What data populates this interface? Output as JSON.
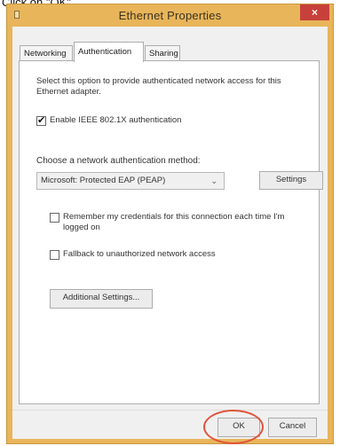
{
  "caption": "Click on \"OK\"",
  "window": {
    "title": "Ethernet Properties",
    "close_glyph": "×"
  },
  "tabs": [
    {
      "label": "Networking",
      "active": false
    },
    {
      "label": "Authentication",
      "active": true
    },
    {
      "label": "Sharing",
      "active": false
    }
  ],
  "panel": {
    "description": "Select this option to provide authenticated network access for this Ethernet adapter.",
    "enable_8021x": {
      "label": "Enable IEEE 802.1X authentication",
      "checked": true
    },
    "method_label": "Choose a network authentication method:",
    "method_select": {
      "value": "Microsoft: Protected EAP (PEAP)"
    },
    "settings_button": "Settings",
    "remember_credentials": {
      "label": "Remember my credentials for this connection each time I'm logged on",
      "checked": false
    },
    "fallback": {
      "label": "Fallback to unauthorized network access",
      "checked": false
    },
    "additional_settings_button": "Additional Settings..."
  },
  "footer": {
    "ok_button": "OK",
    "cancel_button": "Cancel"
  },
  "icons": {
    "checkmark": "✔",
    "dropdown": "⌄"
  },
  "colors": {
    "titlebar": "#e8b55a",
    "close_button": "#c7413a",
    "highlight": "#e0533b"
  }
}
